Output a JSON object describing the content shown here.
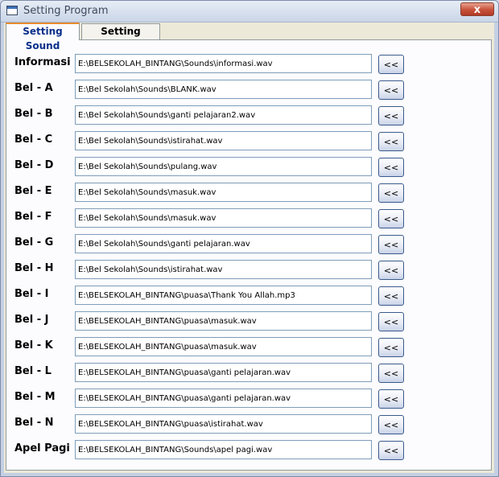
{
  "window": {
    "title": "Setting Program",
    "close_label": "x"
  },
  "tabs": [
    {
      "label": "Setting Sound",
      "active": true
    },
    {
      "label": "Setting Jadwal",
      "active": false
    }
  ],
  "browse_label": "<<",
  "rows": [
    {
      "label": "Informasi",
      "path": "E:\\BELSEKOLAH_BINTANG\\Sounds\\informasi.wav"
    },
    {
      "label": "Bel - A",
      "path": "E:\\Bel Sekolah\\Sounds\\BLANK.wav"
    },
    {
      "label": "Bel - B",
      "path": "E:\\Bel Sekolah\\Sounds\\ganti pelajaran2.wav"
    },
    {
      "label": "Bel - C",
      "path": "E:\\Bel Sekolah\\Sounds\\istirahat.wav"
    },
    {
      "label": "Bel - D",
      "path": "E:\\Bel Sekolah\\Sounds\\pulang.wav"
    },
    {
      "label": "Bel - E",
      "path": "E:\\Bel Sekolah\\Sounds\\masuk.wav"
    },
    {
      "label": "Bel - F",
      "path": "E:\\Bel Sekolah\\Sounds\\masuk.wav"
    },
    {
      "label": "Bel - G",
      "path": "E:\\Bel Sekolah\\Sounds\\ganti pelajaran.wav"
    },
    {
      "label": "Bel - H",
      "path": "E:\\Bel Sekolah\\Sounds\\istirahat.wav"
    },
    {
      "label": "Bel - I",
      "path": "E:\\BELSEKOLAH_BINTANG\\puasa\\Thank You Allah.mp3"
    },
    {
      "label": "Bel - J",
      "path": "E:\\BELSEKOLAH_BINTANG\\puasa\\masuk.wav"
    },
    {
      "label": "Bel - K",
      "path": "E:\\BELSEKOLAH_BINTANG\\puasa\\masuk.wav"
    },
    {
      "label": "Bel - L",
      "path": "E:\\BELSEKOLAH_BINTANG\\puasa\\ganti pelajaran.wav"
    },
    {
      "label": "Bel - M",
      "path": "E:\\BELSEKOLAH_BINTANG\\puasa\\ganti pelajaran.wav"
    },
    {
      "label": "Bel - N",
      "path": "E:\\BELSEKOLAH_BINTANG\\puasa\\istirahat.wav"
    },
    {
      "label": "Apel Pagi",
      "path": "E:\\BELSEKOLAH_BINTANG\\Sounds\\apel pagi.wav"
    }
  ]
}
